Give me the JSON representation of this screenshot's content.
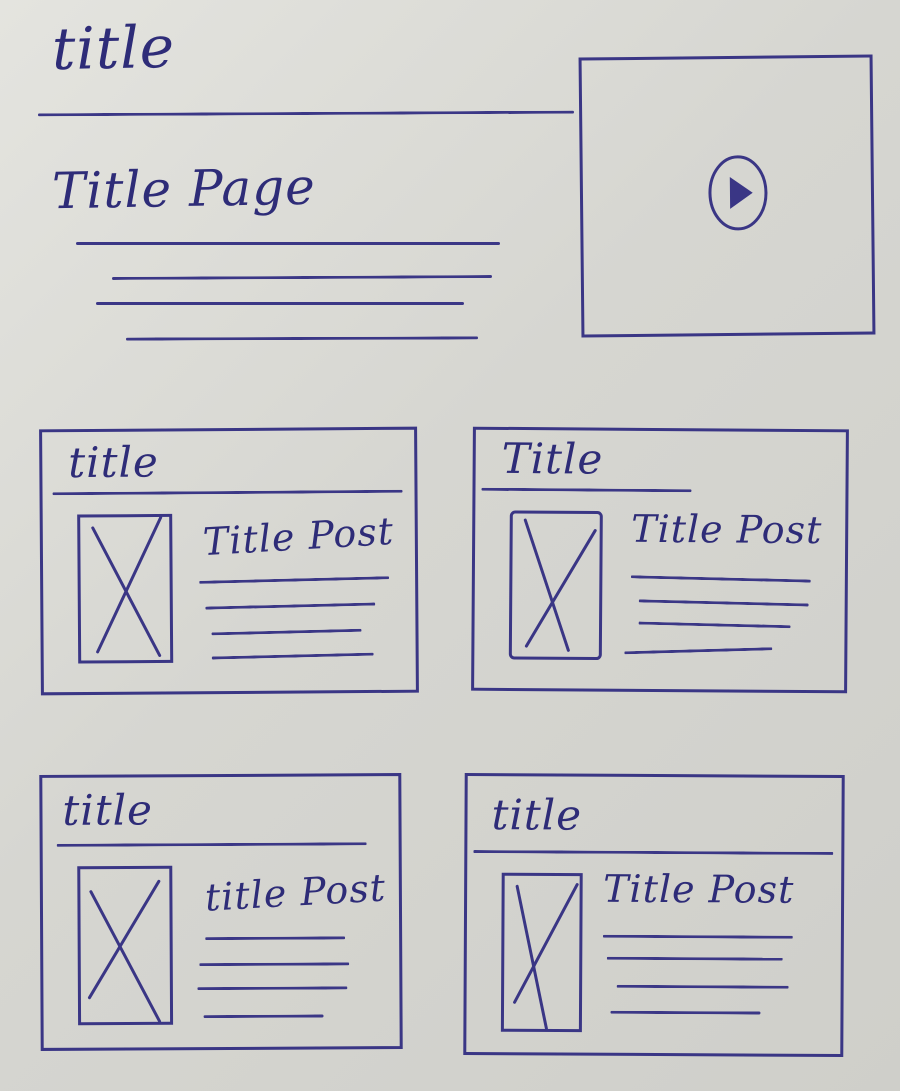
{
  "header": {
    "site_title": "title",
    "page_title": "Title Page"
  },
  "video": {
    "icon": "play-icon"
  },
  "cards": [
    {
      "title": "title",
      "post_title": "Title Post",
      "image_icon": "image-placeholder-icon"
    },
    {
      "title": "Title",
      "post_title": "Title Post",
      "image_icon": "image-placeholder-icon"
    },
    {
      "title": "title",
      "post_title": "title Post",
      "image_icon": "image-placeholder-icon"
    },
    {
      "title": "title",
      "post_title": "Title Post",
      "image_icon": "image-placeholder-icon"
    }
  ],
  "colors": {
    "ink": "#3a3685",
    "paper": "#d9d9d4"
  }
}
